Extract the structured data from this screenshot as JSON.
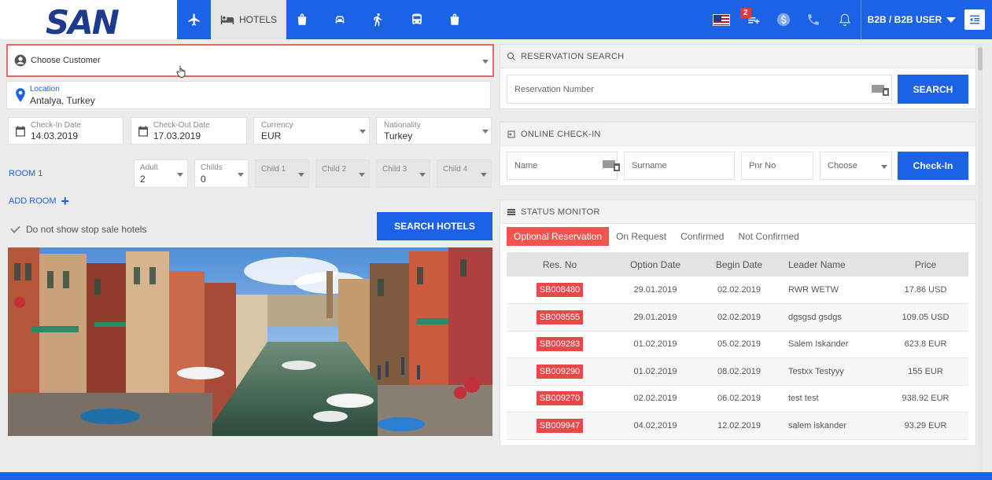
{
  "brand": {
    "logo_text": "SAN"
  },
  "nav": {
    "hotels_label": "HOTELS",
    "notification_count": "2",
    "user_label": "B2B / B2B USER"
  },
  "search": {
    "customer_placeholder": "Choose Customer",
    "location_label": "Location",
    "location_value": "Antalya, Turkey",
    "checkin_label": "Check-In Date",
    "checkin_value": "14.03.2019",
    "checkout_label": "Check-Out Date",
    "checkout_value": "17.03.2019",
    "currency_label": "Currency",
    "currency_value": "EUR",
    "nationality_label": "Nationality",
    "nationality_value": "Turkey",
    "room_label": "ROOM 1",
    "adult_label": "Adult",
    "adult_value": "2",
    "childs_label": "Childs",
    "childs_value": "0",
    "child1_label": "Child 1",
    "child2_label": "Child 2",
    "child3_label": "Child 3",
    "child4_label": "Child 4",
    "add_room_label": "ADD ROOM",
    "stop_sale_label": "Do not show stop sale hotels",
    "search_button": "SEARCH HOTELS"
  },
  "reservation_search": {
    "title": "RESERVATION SEARCH",
    "number_placeholder": "Reservation Number",
    "button": "SEARCH"
  },
  "online_checkin": {
    "title": "ONLINE CHECK-IN",
    "name_placeholder": "Name",
    "surname_placeholder": "Surname",
    "pnr_placeholder": "Pnr No",
    "choose_label": "Choose",
    "button": "Check-In"
  },
  "status_monitor": {
    "title": "STATUS MONITOR",
    "tabs": [
      "Optional Reservation",
      "On Request",
      "Confirmed",
      "Not Confirmed"
    ],
    "columns": [
      "Res. No",
      "Option Date",
      "Begin Date",
      "Leader Name",
      "Price"
    ],
    "rows": [
      [
        "SB008480",
        "29.01.2019",
        "02.02.2019",
        "RWR WETW",
        "17.86 USD"
      ],
      [
        "SB008555",
        "29.01.2019",
        "02.02.2019",
        "dgsgsd gsdgs",
        "109.05 USD"
      ],
      [
        "SB009283",
        "01.02.2019",
        "05.02.2019",
        "Salem Iskander",
        "623.8 EUR"
      ],
      [
        "SB009290",
        "01.02.2019",
        "08.02.2019",
        "Testxx Testyyy",
        "155 EUR"
      ],
      [
        "SB009270",
        "02.02.2019",
        "06.02.2019",
        "test test",
        "938.92 EUR"
      ],
      [
        "SB009947",
        "04.02.2019",
        "12.02.2019",
        "salem iskander",
        "93.29 EUR"
      ]
    ]
  },
  "colors": {
    "primary": "#1b62e6",
    "danger": "#e84848",
    "highlight_border": "#e06c6c"
  }
}
